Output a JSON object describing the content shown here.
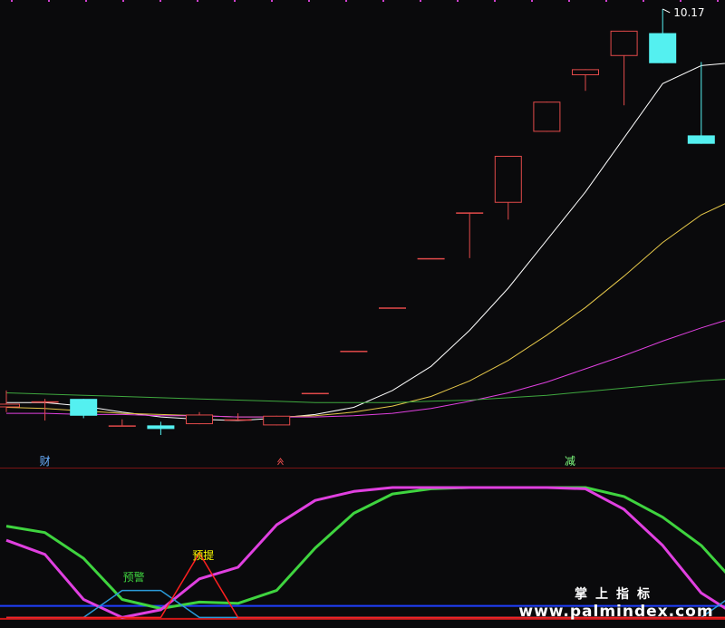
{
  "chart_data": [
    {
      "type": "candlestick",
      "price_label": "10.17",
      "ylim": [
        6.8,
        10.4
      ],
      "candles": [
        {
          "o": 7.06,
          "h": 7.2,
          "l": 7.02,
          "c": 7.09
        },
        {
          "o": 7.11,
          "h": 7.13,
          "l": 6.95,
          "c": 7.11
        },
        {
          "o": 7.13,
          "h": 7.13,
          "l": 6.97,
          "c": 6.99
        },
        {
          "o": 6.91,
          "h": 6.96,
          "l": 6.91,
          "c": 6.91
        },
        {
          "o": 6.91,
          "h": 6.94,
          "l": 6.83,
          "c": 6.88
        },
        {
          "o": 6.92,
          "h": 7.02,
          "l": 6.92,
          "c": 7.0
        },
        {
          "o": 6.95,
          "h": 7.01,
          "l": 6.95,
          "c": 6.96
        },
        {
          "o": 6.91,
          "h": 6.99,
          "l": 6.91,
          "c": 6.99
        },
        {
          "o": 7.18,
          "h": 7.18,
          "l": 7.18,
          "c": 7.18
        },
        {
          "o": 7.53,
          "h": 7.53,
          "l": 7.53,
          "c": 7.53
        },
        {
          "o": 7.89,
          "h": 7.89,
          "l": 7.89,
          "c": 7.89
        },
        {
          "o": 8.3,
          "h": 8.3,
          "l": 8.3,
          "c": 8.3
        },
        {
          "o": 8.68,
          "h": 8.68,
          "l": 8.3,
          "c": 8.68
        },
        {
          "o": 8.76,
          "h": 9.15,
          "l": 8.62,
          "c": 9.15
        },
        {
          "o": 9.35,
          "h": 9.6,
          "l": 9.35,
          "c": 9.6
        },
        {
          "o": 9.82,
          "h": 9.82,
          "l": 9.69,
          "c": 9.87
        },
        {
          "o": 9.98,
          "h": 10.09,
          "l": 9.57,
          "c": 10.19
        },
        {
          "o": 10.17,
          "h": 10.37,
          "l": 9.92,
          "c": 9.92
        },
        {
          "o": 9.32,
          "h": 9.93,
          "l": 9.32,
          "c": 9.25
        }
      ],
      "ma": [
        {
          "color": "#ffffff",
          "values": [
            7.1,
            7.1,
            7.07,
            7.02,
            6.98,
            6.96,
            6.95,
            6.97,
            7.0,
            7.06,
            7.2,
            7.4,
            7.7,
            8.05,
            8.45,
            8.85,
            9.3,
            9.75,
            9.9,
            9.93
          ]
        },
        {
          "color": "#e6c84a",
          "values": [
            7.06,
            7.05,
            7.03,
            7.01,
            7.0,
            6.99,
            6.98,
            6.98,
            6.99,
            7.02,
            7.07,
            7.15,
            7.28,
            7.45,
            7.66,
            7.89,
            8.15,
            8.43,
            8.66,
            8.81
          ]
        },
        {
          "color": "#e040e0",
          "values": [
            7.01,
            7.01,
            7.0,
            7.0,
            6.99,
            6.99,
            6.98,
            6.98,
            6.98,
            6.99,
            7.01,
            7.05,
            7.11,
            7.18,
            7.27,
            7.38,
            7.49,
            7.61,
            7.72,
            7.82
          ]
        },
        {
          "color": "#3fa83f",
          "values": [
            7.18,
            7.17,
            7.16,
            7.15,
            7.14,
            7.13,
            7.12,
            7.11,
            7.1,
            7.1,
            7.1,
            7.11,
            7.12,
            7.14,
            7.16,
            7.19,
            7.22,
            7.25,
            7.28,
            7.3
          ]
        }
      ],
      "markers": [
        {
          "label": "财",
          "index": 1,
          "color": "#6ab0ff"
        },
        {
          "label": "减",
          "index": 14.6,
          "color": "#7fff7f"
        }
      ],
      "arrow_index": 7.1
    },
    {
      "type": "line",
      "ylim": [
        0,
        100
      ],
      "labels": [
        {
          "text": "预警",
          "index": 3.3,
          "color": "#3fd43f"
        },
        {
          "text": "预提",
          "index": 5.1,
          "color": "#ffff00"
        }
      ],
      "series": [
        {
          "color": "#3fd43f",
          "values": [
            70,
            65,
            45,
            13,
            6,
            11,
            10,
            20,
            53,
            80,
            95,
            99,
            100,
            100,
            100,
            100,
            93,
            77,
            55,
            22
          ]
        },
        {
          "color": "#e040e0",
          "values": [
            59,
            48,
            13,
            -1,
            5,
            29,
            38,
            71,
            90,
            97,
            100,
            100,
            100,
            100,
            100,
            99,
            83,
            55,
            18,
            -1
          ]
        },
        {
          "color": "#2a9ad8",
          "values": [
            -1,
            -1,
            -1,
            20,
            20,
            -1,
            -1,
            -1,
            -1,
            -1,
            -1,
            -1,
            -1,
            -1,
            -1,
            -1,
            -1,
            -1,
            -1,
            20
          ]
        },
        {
          "color": "#ff2020",
          "values": [
            -1,
            -1,
            -1,
            -1,
            -1,
            49,
            -1,
            -1,
            -1,
            -1,
            -1,
            -1,
            -1,
            -1,
            -1,
            -1,
            -1,
            -1,
            -1,
            -1
          ]
        }
      ],
      "baselines": [
        {
          "color": "#1f3fff",
          "value": 8
        },
        {
          "color": "#d01818",
          "value": -2
        }
      ]
    }
  ],
  "watermark": {
    "cn": "掌上指标",
    "url": "www.palmindex.com"
  }
}
